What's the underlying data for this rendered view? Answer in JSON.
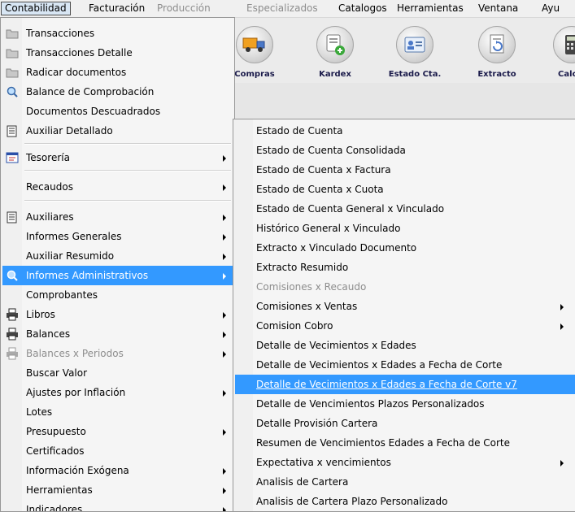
{
  "menubar": {
    "items": [
      {
        "label": "Contabilidad",
        "state": "active"
      },
      {
        "label": "Facturación",
        "state": "normal"
      },
      {
        "label": "Producción",
        "state": "disabled"
      },
      {
        "label": "Especializados",
        "state": "disabled"
      },
      {
        "label": "Catalogos",
        "state": "normal"
      },
      {
        "label": "Herramientas",
        "state": "normal"
      },
      {
        "label": "Ventana",
        "state": "normal"
      },
      {
        "label": "Ayu",
        "state": "normal"
      }
    ]
  },
  "toolbar": {
    "buttons": [
      {
        "label": "Compras",
        "icon": "truck-icon"
      },
      {
        "label": "Kardex",
        "icon": "kardex-add-icon"
      },
      {
        "label": "Estado Cta.",
        "icon": "id-card-icon"
      },
      {
        "label": "Extracto",
        "icon": "document-refresh-icon"
      },
      {
        "label": "Calcul",
        "icon": "calculator-icon"
      }
    ]
  },
  "contabilidad_menu": {
    "items": [
      {
        "label": "Transacciones",
        "icon": "folder-icon"
      },
      {
        "label": "Transacciones Detalle",
        "icon": "folder-icon"
      },
      {
        "label": "Radicar documentos",
        "icon": "folder-icon"
      },
      {
        "label": "Balance de Comprobación",
        "icon": "magnifier-icon"
      },
      {
        "label": "Documentos Descuadrados",
        "icon": ""
      },
      {
        "label": "Auxiliar Detallado",
        "icon": "ledger-icon"
      },
      {
        "label": "Tesorería",
        "icon": "treasury-icon",
        "submenu": true
      },
      {
        "label": "Recaudos",
        "submenu": true
      },
      {
        "label": "Auxiliares",
        "icon": "ledger-icon",
        "submenu": true
      },
      {
        "label": "Informes Generales",
        "submenu": true
      },
      {
        "label": "Auxiliar Resumido",
        "submenu": true
      },
      {
        "label": "Informes Administrativos",
        "icon": "magnifier-icon",
        "submenu": true,
        "highlighted": true
      },
      {
        "label": "Comprobantes"
      },
      {
        "label": "Libros",
        "icon": "printer-icon",
        "submenu": true
      },
      {
        "label": "Balances",
        "icon": "printer-icon",
        "submenu": true
      },
      {
        "label": "Balances x Periodos",
        "icon": "printer-icon",
        "submenu": true,
        "disabled": true
      },
      {
        "label": "Buscar Valor"
      },
      {
        "label": "Ajustes por Inflación",
        "submenu": true
      },
      {
        "label": "Lotes"
      },
      {
        "label": "Presupuesto",
        "submenu": true
      },
      {
        "label": "Certificados"
      },
      {
        "label": "Información Exógena",
        "submenu": true
      },
      {
        "label": "Herramientas",
        "submenu": true
      },
      {
        "label": "Indicadores",
        "submenu": true
      }
    ]
  },
  "informes_submenu": {
    "items": [
      {
        "label": "Estado de Cuenta"
      },
      {
        "label": "Estado de Cuenta Consolidada"
      },
      {
        "label": "Estado de Cuenta x Factura"
      },
      {
        "label": "Estado de Cuenta x Cuota"
      },
      {
        "label": "Estado de Cuenta General x Vinculado"
      },
      {
        "label": "Histórico General x Vinculado"
      },
      {
        "label": "Extracto x Vinculado Documento"
      },
      {
        "label": "Extracto Resumido"
      },
      {
        "label": "Comisiones x Recaudo",
        "disabled": true
      },
      {
        "label": "Comisiones x Ventas",
        "submenu": true
      },
      {
        "label": "Comision Cobro",
        "submenu": true
      },
      {
        "label": "Detalle de Vecimientos x Edades"
      },
      {
        "label": "Detalle de Vecimientos x Edades a Fecha de Corte"
      },
      {
        "label": "Detalle de Vecimientos x Edades a Fecha de Corte v7",
        "highlighted": true
      },
      {
        "label": "Detalle de Vencimientos Plazos Personalizados"
      },
      {
        "label": "Detalle Provisión Cartera"
      },
      {
        "label": "Resumen de Vencimientos Edades a Fecha de Corte"
      },
      {
        "label": "Expectativa x vencimientos",
        "submenu": true
      },
      {
        "label": "Analisis de Cartera"
      },
      {
        "label": "Analisis de Cartera Plazo Personalizado"
      }
    ]
  },
  "colors": {
    "highlight": "#3399ff",
    "disabled": "#8d8d8d",
    "menu_bg": "#f5f5f5"
  }
}
